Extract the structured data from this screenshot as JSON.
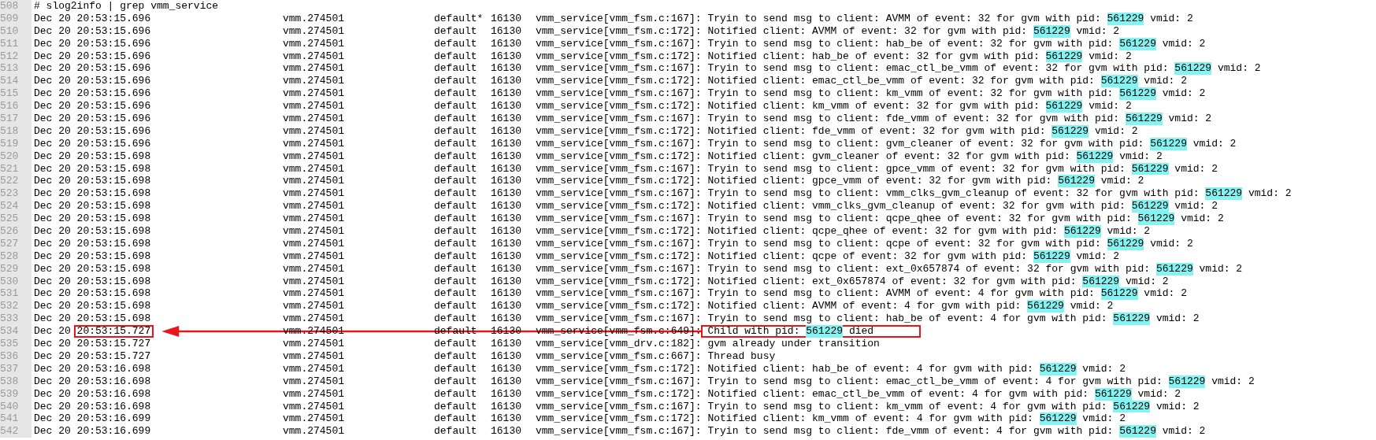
{
  "rows": [
    {
      "line": "508",
      "kind": "command",
      "text": "# slog2info | grep vmm_service"
    },
    {
      "line": "509",
      "kind": "entry",
      "date": "Dec 20",
      "time": "20:53:15.696",
      "process": "vmm.274501",
      "level": "default*",
      "tid": "16130",
      "source": "vmm_service[vmm_fsm.c:167]:",
      "before": "Tryin to send msg to client: AVMM of event: 32 for gvm with pid: ",
      "match": "561229",
      "after": " vmid: 2"
    },
    {
      "line": "510",
      "kind": "entry",
      "date": "Dec 20",
      "time": "20:53:15.696",
      "process": "vmm.274501",
      "level": "default",
      "tid": "16130",
      "source": "vmm_service[vmm_fsm.c:172]:",
      "before": "Notified client: AVMM of event: 32 for gvm with pid: ",
      "match": "561229",
      "after": " vmid: 2"
    },
    {
      "line": "511",
      "kind": "entry",
      "date": "Dec 20",
      "time": "20:53:15.696",
      "process": "vmm.274501",
      "level": "default",
      "tid": "16130",
      "source": "vmm_service[vmm_fsm.c:167]:",
      "before": "Tryin to send msg to client: hab_be of event: 32 for gvm with pid: ",
      "match": "561229",
      "after": " vmid: 2"
    },
    {
      "line": "512",
      "kind": "entry",
      "date": "Dec 20",
      "time": "20:53:15.696",
      "process": "vmm.274501",
      "level": "default",
      "tid": "16130",
      "source": "vmm_service[vmm_fsm.c:172]:",
      "before": "Notified client: hab_be of event: 32 for gvm with pid: ",
      "match": "561229",
      "after": " vmid: 2"
    },
    {
      "line": "513",
      "kind": "entry",
      "date": "Dec 20",
      "time": "20:53:15.696",
      "process": "vmm.274501",
      "level": "default",
      "tid": "16130",
      "source": "vmm_service[vmm_fsm.c:167]:",
      "before": "Tryin to send msg to client: emac_ctl_be_vmm of event: 32 for gvm with pid: ",
      "match": "561229",
      "after": " vmid: 2"
    },
    {
      "line": "514",
      "kind": "entry",
      "date": "Dec 20",
      "time": "20:53:15.696",
      "process": "vmm.274501",
      "level": "default",
      "tid": "16130",
      "source": "vmm_service[vmm_fsm.c:172]:",
      "before": "Notified client: emac_ctl_be_vmm of event: 32 for gvm with pid: ",
      "match": "561229",
      "after": " vmid: 2"
    },
    {
      "line": "515",
      "kind": "entry",
      "date": "Dec 20",
      "time": "20:53:15.696",
      "process": "vmm.274501",
      "level": "default",
      "tid": "16130",
      "source": "vmm_service[vmm_fsm.c:167]:",
      "before": "Tryin to send msg to client: km_vmm of event: 32 for gvm with pid: ",
      "match": "561229",
      "after": " vmid: 2"
    },
    {
      "line": "516",
      "kind": "entry",
      "date": "Dec 20",
      "time": "20:53:15.696",
      "process": "vmm.274501",
      "level": "default",
      "tid": "16130",
      "source": "vmm_service[vmm_fsm.c:172]:",
      "before": "Notified client: km_vmm of event: 32 for gvm with pid: ",
      "match": "561229",
      "after": " vmid: 2"
    },
    {
      "line": "517",
      "kind": "entry",
      "date": "Dec 20",
      "time": "20:53:15.696",
      "process": "vmm.274501",
      "level": "default",
      "tid": "16130",
      "source": "vmm_service[vmm_fsm.c:167]:",
      "before": "Tryin to send msg to client: fde_vmm of event: 32 for gvm with pid: ",
      "match": "561229",
      "after": " vmid: 2"
    },
    {
      "line": "518",
      "kind": "entry",
      "date": "Dec 20",
      "time": "20:53:15.696",
      "process": "vmm.274501",
      "level": "default",
      "tid": "16130",
      "source": "vmm_service[vmm_fsm.c:172]:",
      "before": "Notified client: fde_vmm of event: 32 for gvm with pid: ",
      "match": "561229",
      "after": " vmid: 2"
    },
    {
      "line": "519",
      "kind": "entry",
      "date": "Dec 20",
      "time": "20:53:15.696",
      "process": "vmm.274501",
      "level": "default",
      "tid": "16130",
      "source": "vmm_service[vmm_fsm.c:167]:",
      "before": "Tryin to send msg to client: gvm_cleaner of event: 32 for gvm with pid: ",
      "match": "561229",
      "after": " vmid: 2"
    },
    {
      "line": "520",
      "kind": "entry",
      "date": "Dec 20",
      "time": "20:53:15.698",
      "process": "vmm.274501",
      "level": "default",
      "tid": "16130",
      "source": "vmm_service[vmm_fsm.c:172]:",
      "before": "Notified client: gvm_cleaner of event: 32 for gvm with pid: ",
      "match": "561229",
      "after": " vmid: 2"
    },
    {
      "line": "521",
      "kind": "entry",
      "date": "Dec 20",
      "time": "20:53:15.698",
      "process": "vmm.274501",
      "level": "default",
      "tid": "16130",
      "source": "vmm_service[vmm_fsm.c:167]:",
      "before": "Tryin to send msg to client: gpce_vmm of event: 32 for gvm with pid: ",
      "match": "561229",
      "after": " vmid: 2"
    },
    {
      "line": "522",
      "kind": "entry",
      "date": "Dec 20",
      "time": "20:53:15.698",
      "process": "vmm.274501",
      "level": "default",
      "tid": "16130",
      "source": "vmm_service[vmm_fsm.c:172]:",
      "before": "Notified client: gpce_vmm of event: 32 for gvm with pid: ",
      "match": "561229",
      "after": " vmid: 2"
    },
    {
      "line": "523",
      "kind": "entry",
      "date": "Dec 20",
      "time": "20:53:15.698",
      "process": "vmm.274501",
      "level": "default",
      "tid": "16130",
      "source": "vmm_service[vmm_fsm.c:167]:",
      "before": "Tryin to send msg to client: vmm_clks_gvm_cleanup of event: 32 for gvm with pid: ",
      "match": "561229",
      "after": " vmid: 2"
    },
    {
      "line": "524",
      "kind": "entry",
      "date": "Dec 20",
      "time": "20:53:15.698",
      "process": "vmm.274501",
      "level": "default",
      "tid": "16130",
      "source": "vmm_service[vmm_fsm.c:172]:",
      "before": "Notified client: vmm_clks_gvm_cleanup of event: 32 for gvm with pid: ",
      "match": "561229",
      "after": " vmid: 2"
    },
    {
      "line": "525",
      "kind": "entry",
      "date": "Dec 20",
      "time": "20:53:15.698",
      "process": "vmm.274501",
      "level": "default",
      "tid": "16130",
      "source": "vmm_service[vmm_fsm.c:167]:",
      "before": "Tryin to send msg to client: qcpe_qhee of event: 32 for gvm with pid: ",
      "match": "561229",
      "after": " vmid: 2"
    },
    {
      "line": "526",
      "kind": "entry",
      "date": "Dec 20",
      "time": "20:53:15.698",
      "process": "vmm.274501",
      "level": "default",
      "tid": "16130",
      "source": "vmm_service[vmm_fsm.c:172]:",
      "before": "Notified client: qcpe_qhee of event: 32 for gvm with pid: ",
      "match": "561229",
      "after": " vmid: 2"
    },
    {
      "line": "527",
      "kind": "entry",
      "date": "Dec 20",
      "time": "20:53:15.698",
      "process": "vmm.274501",
      "level": "default",
      "tid": "16130",
      "source": "vmm_service[vmm_fsm.c:167]:",
      "before": "Tryin to send msg to client: qcpe of event: 32 for gvm with pid: ",
      "match": "561229",
      "after": " vmid: 2"
    },
    {
      "line": "528",
      "kind": "entry",
      "date": "Dec 20",
      "time": "20:53:15.698",
      "process": "vmm.274501",
      "level": "default",
      "tid": "16130",
      "source": "vmm_service[vmm_fsm.c:172]:",
      "before": "Notified client: qcpe of event: 32 for gvm with pid: ",
      "match": "561229",
      "after": " vmid: 2"
    },
    {
      "line": "529",
      "kind": "entry",
      "date": "Dec 20",
      "time": "20:53:15.698",
      "process": "vmm.274501",
      "level": "default",
      "tid": "16130",
      "source": "vmm_service[vmm_fsm.c:167]:",
      "before": "Tryin to send msg to client: ext_0x657874 of event: 32 for gvm with pid: ",
      "match": "561229",
      "after": " vmid: 2"
    },
    {
      "line": "530",
      "kind": "entry",
      "date": "Dec 20",
      "time": "20:53:15.698",
      "process": "vmm.274501",
      "level": "default",
      "tid": "16130",
      "source": "vmm_service[vmm_fsm.c:172]:",
      "before": "Notified client: ext_0x657874 of event: 32 for gvm with pid: ",
      "match": "561229",
      "after": " vmid: 2"
    },
    {
      "line": "531",
      "kind": "entry",
      "date": "Dec 20",
      "time": "20:53:15.698",
      "process": "vmm.274501",
      "level": "default",
      "tid": "16130",
      "source": "vmm_service[vmm_fsm.c:167]:",
      "before": "Tryin to send msg to client: AVMM of event: 4 for gvm with pid: ",
      "match": "561229",
      "after": " vmid: 2"
    },
    {
      "line": "532",
      "kind": "entry",
      "date": "Dec 20",
      "time": "20:53:15.698",
      "process": "vmm.274501",
      "level": "default",
      "tid": "16130",
      "source": "vmm_service[vmm_fsm.c:172]:",
      "before": "Notified client: AVMM of event: 4 for gvm with pid: ",
      "match": "561229",
      "after": " vmid: 2"
    },
    {
      "line": "533",
      "kind": "entry",
      "date": "Dec 20",
      "time": "20:53:15.698",
      "process": "vmm.274501",
      "level": "default",
      "tid": "16130",
      "source": "vmm_service[vmm_fsm.c:167]:",
      "before": "Tryin to send msg to client: hab_be of event: 4 for gvm with pid: ",
      "match": "561229",
      "after": " vmid: 2"
    },
    {
      "line": "534",
      "kind": "entry",
      "marked": true,
      "date": "Dec 20",
      "time": "20:53:15.727",
      "process": "vmm.274501",
      "level": "default",
      "tid": "16130",
      "source": "vmm_service[vmm_fsm.c:649]:",
      "before": "Child with pid: ",
      "match": "561229",
      "after": " died"
    },
    {
      "line": "535",
      "kind": "entry",
      "date": "Dec 20",
      "time": "20:53:15.727",
      "process": "vmm.274501",
      "level": "default",
      "tid": "16130",
      "source": "vmm_service[vmm_drv.c:182]:",
      "before": "gvm already under transition"
    },
    {
      "line": "536",
      "kind": "entry",
      "date": "Dec 20",
      "time": "20:53:15.727",
      "process": "vmm.274501",
      "level": "default",
      "tid": "16130",
      "source": "vmm_service[vmm_fsm.c:667]:",
      "before": "Thread busy"
    },
    {
      "line": "537",
      "kind": "entry",
      "date": "Dec 20",
      "time": "20:53:16.698",
      "process": "vmm.274501",
      "level": "default",
      "tid": "16130",
      "source": "vmm_service[vmm_fsm.c:172]:",
      "before": "Notified client: hab_be of event: 4 for gvm with pid: ",
      "match": "561229",
      "after": " vmid: 2"
    },
    {
      "line": "538",
      "kind": "entry",
      "date": "Dec 20",
      "time": "20:53:16.698",
      "process": "vmm.274501",
      "level": "default",
      "tid": "16130",
      "source": "vmm_service[vmm_fsm.c:167]:",
      "before": "Tryin to send msg to client: emac_ctl_be_vmm of event: 4 for gvm with pid: ",
      "match": "561229",
      "after": " vmid: 2"
    },
    {
      "line": "539",
      "kind": "entry",
      "date": "Dec 20",
      "time": "20:53:16.698",
      "process": "vmm.274501",
      "level": "default",
      "tid": "16130",
      "source": "vmm_service[vmm_fsm.c:172]:",
      "before": "Notified client: emac_ctl_be_vmm of event: 4 for gvm with pid: ",
      "match": "561229",
      "after": " vmid: 2"
    },
    {
      "line": "540",
      "kind": "entry",
      "date": "Dec 20",
      "time": "20:53:16.698",
      "process": "vmm.274501",
      "level": "default",
      "tid": "16130",
      "source": "vmm_service[vmm_fsm.c:167]:",
      "before": "Tryin to send msg to client: km_vmm of event: 4 for gvm with pid: ",
      "match": "561229",
      "after": " vmid: 2"
    },
    {
      "line": "541",
      "kind": "entry",
      "date": "Dec 20",
      "time": "20:53:16.699",
      "process": "vmm.274501",
      "level": "default",
      "tid": "16130",
      "source": "vmm_service[vmm_fsm.c:172]:",
      "before": "Notified client: km_vmm of event: 4 for gvm with pid: ",
      "match": "561229",
      "after": " vmid: 2"
    },
    {
      "line": "542",
      "kind": "entry",
      "date": "Dec 20",
      "time": "20:53:16.699",
      "process": "vmm.274501",
      "level": "default",
      "tid": "16130",
      "source": "vmm_service[vmm_fsm.c:167]:",
      "before": "Tryin to send msg to client: fde_vmm of event: 4 for gvm with pid: ",
      "match": "561229",
      "after": " vmid: 2"
    }
  ]
}
